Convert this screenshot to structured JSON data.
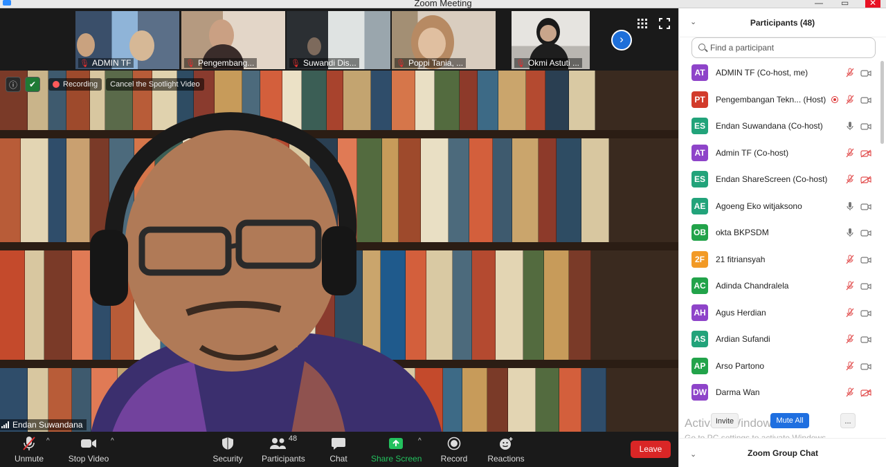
{
  "window": {
    "title": "Zoom Meeting"
  },
  "gallery": {
    "tiles": [
      {
        "name": "ADMIN TF",
        "bg": "#6f8aa8"
      },
      {
        "name": "Pengembang...",
        "bg": "#c9b7a5"
      },
      {
        "name": "Suwandi Dis...",
        "bg": "#c4c8c6"
      },
      {
        "name": "Poppi Tania, ...",
        "bg": "#b9a791"
      },
      {
        "name": "Okmi Astuti ...",
        "bg": "#d8d6d2"
      }
    ]
  },
  "main_video": {
    "recording_label": "Recording",
    "spotlight_label": "Cancel the Spotlight Video",
    "speaker_name": "Endan Suwandana"
  },
  "toolbar": {
    "unmute": "Unmute",
    "stop_video": "Stop Video",
    "security": "Security",
    "participants": "Participants",
    "participants_count": "48",
    "chat": "Chat",
    "share_screen": "Share Screen",
    "record": "Record",
    "reactions": "Reactions",
    "leave": "Leave"
  },
  "panel": {
    "title": "Participants (48)",
    "search_placeholder": "Find a participant",
    "participants": [
      {
        "initials": "AT",
        "name": "ADMIN TF (Co-host, me)",
        "color": "#8e44c9",
        "mic": "muted",
        "cam": "on"
      },
      {
        "initials": "PT",
        "name": "Pengembangan Tekn... (Host)",
        "color": "#d23b2b",
        "mic": "muted",
        "cam": "on",
        "recording": true
      },
      {
        "initials": "ES",
        "name": "Endan Suwandana (Co-host)",
        "color": "#22a37a",
        "mic": "on",
        "cam": "on"
      },
      {
        "initials": "AT",
        "name": "Admin TF (Co-host)",
        "color": "#8e44c9",
        "mic": "muted",
        "cam": "off"
      },
      {
        "initials": "ES",
        "name": "Endan ShareScreen (Co-host)",
        "color": "#22a37a",
        "mic": "muted",
        "cam": "off"
      },
      {
        "initials": "AE",
        "name": "Agoeng Eko witjaksono",
        "color": "#22a37a",
        "mic": "on",
        "cam": "on"
      },
      {
        "initials": "OB",
        "name": "okta BKPSDM",
        "color": "#22a34a",
        "mic": "on",
        "cam": "on"
      },
      {
        "initials": "2F",
        "name": "21 fitriansyah",
        "color": "#f29a26",
        "mic": "muted",
        "cam": "on"
      },
      {
        "initials": "AC",
        "name": "Adinda Chandralela",
        "color": "#22a34a",
        "mic": "muted",
        "cam": "on"
      },
      {
        "initials": "AH",
        "name": "Agus Herdian",
        "color": "#8e44c9",
        "mic": "muted",
        "cam": "on"
      },
      {
        "initials": "AS",
        "name": "Ardian Sufandi",
        "color": "#22a37a",
        "mic": "muted",
        "cam": "on"
      },
      {
        "initials": "AP",
        "name": "Arso Partono",
        "color": "#22a34a",
        "mic": "muted",
        "cam": "on"
      },
      {
        "initials": "DW",
        "name": "Darma Wan",
        "color": "#8e44c9",
        "mic": "muted",
        "cam": "off"
      }
    ],
    "invite": "Invite",
    "mute_all": "Mute All",
    "more": "...",
    "chat_title": "Zoom Group Chat"
  },
  "watermark": {
    "line1": "Activate Windows",
    "line2": "Go to PC settings to activate Windows."
  }
}
